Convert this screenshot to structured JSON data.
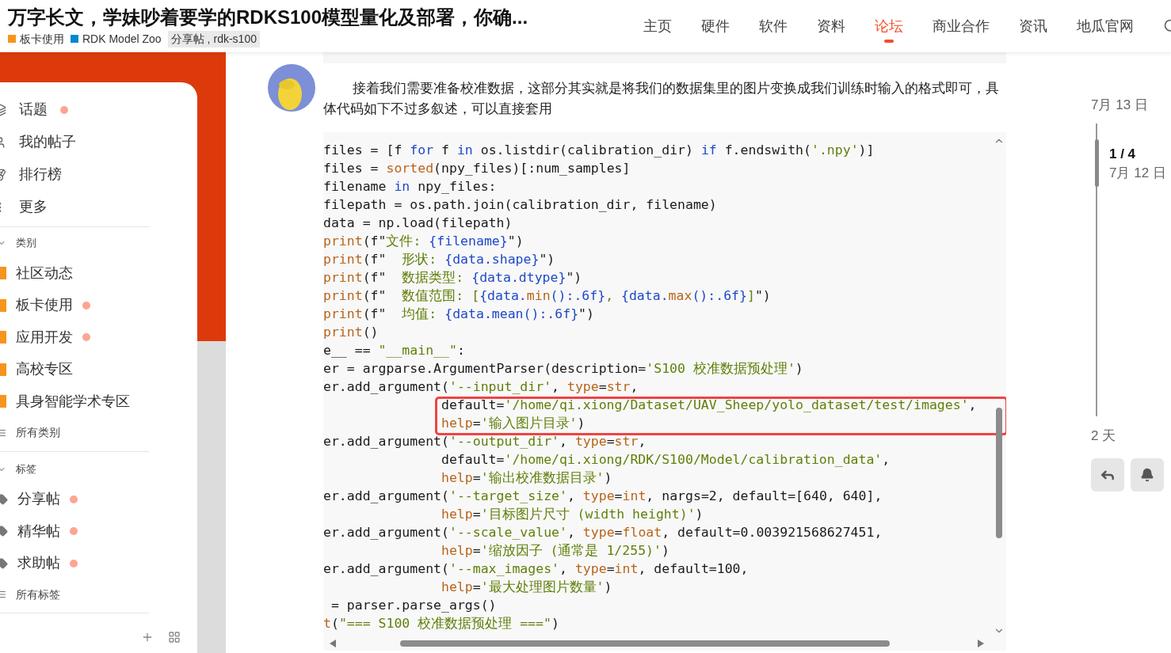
{
  "header": {
    "title": "万字长文，学妹吵着要学的RDKS100模型量化及部署，你确...",
    "categories": [
      {
        "name": "板卡使用",
        "color": "#f7941d"
      },
      {
        "name": "RDK Model Zoo",
        "color": "#0088cc"
      }
    ],
    "tags": [
      "分享帖",
      "rdk-s100"
    ],
    "tag_separator": ",",
    "nav": [
      {
        "label": "主页",
        "selected": false
      },
      {
        "label": "硬件",
        "selected": false
      },
      {
        "label": "软件",
        "selected": false
      },
      {
        "label": "资料",
        "selected": false
      },
      {
        "label": "论坛",
        "selected": true
      },
      {
        "label": "商业合作",
        "selected": false
      },
      {
        "label": "资讯",
        "selected": false
      },
      {
        "label": "地瓜官网",
        "selected": false
      }
    ]
  },
  "sidebar": {
    "items": [
      {
        "label": "话题",
        "kind": "topics",
        "unread": true
      },
      {
        "label": "我的帖子",
        "kind": "user",
        "unread": false
      },
      {
        "label": "排行榜",
        "kind": "ranking",
        "unread": false
      },
      {
        "label": "更多",
        "kind": "more",
        "unread": false
      }
    ],
    "categories": {
      "heading": "类别",
      "expanded": true,
      "items": [
        {
          "label": "社区动态",
          "color": "#f7941d",
          "unread": false
        },
        {
          "label": "板卡使用",
          "color": "#f7941d",
          "unread": true
        },
        {
          "label": "应用开发",
          "color": "#f7941d",
          "unread": true
        },
        {
          "label": "高校专区",
          "color": "#f7941d",
          "unread": false
        },
        {
          "label": "具身智能学术专区",
          "color": "#f7941d",
          "unread": false
        }
      ],
      "footer": "所有类别"
    },
    "tags": {
      "heading": "标签",
      "expanded": true,
      "items": [
        {
          "label": "分享帖",
          "unread": true
        },
        {
          "label": "精华帖",
          "unread": true
        },
        {
          "label": "求助帖",
          "unread": true
        }
      ],
      "footer": "所有标签"
    }
  },
  "post": {
    "paragraph": "接着我们需要准备校准数据，这部分其实就是将我们的数据集里的图片变换成我们训练时输入的格式即可，具体代码如下不过多叙述，可以直接套用",
    "code_blocks": [
      {
        "kind": "plain",
        "lines": [
          {
            "kind": "statement",
            "segments": [
              {
                "text": "files = [f ",
                "kind": "plain"
              },
              {
                "text": "for",
                "kind": "keyword"
              },
              {
                "text": " f ",
                "kind": "plain"
              },
              {
                "text": "in",
                "kind": "keyword"
              },
              {
                "text": " os.listdir(calibration_dir) ",
                "kind": "plain"
              },
              {
                "text": "if",
                "kind": "keyword"
              },
              {
                "text": " f.endswith(",
                "kind": "plain"
              },
              {
                "text": "'.npy'",
                "kind": "string"
              },
              {
                "text": ")]",
                "kind": "plain"
              }
            ]
          },
          {
            "kind": "statement",
            "segments": [
              {
                "text": "files = ",
                "kind": "plain"
              },
              {
                "text": "sorted",
                "kind": "builtin"
              },
              {
                "text": "(npy_files)[:num_samples]",
                "kind": "plain"
              }
            ]
          },
          {
            "kind": "statement",
            "segments": [
              {
                "text": "filename ",
                "kind": "plain"
              },
              {
                "text": "in",
                "kind": "keyword"
              },
              {
                "text": " npy_files:",
                "kind": "plain"
              }
            ]
          },
          {
            "kind": "statement",
            "segments": [
              {
                "text": "filepath = os.path.join(calibration_dir, filename)",
                "kind": "plain"
              }
            ]
          },
          {
            "kind": "statement",
            "segments": [
              {
                "text": "data = np.load(filepath)",
                "kind": "plain"
              }
            ]
          },
          {
            "kind": "statement",
            "segments": [
              {
                "text": "print",
                "kind": "builtin"
              },
              {
                "text": "(f\"",
                "kind": "plain"
              },
              {
                "text": "文件: ",
                "kind": "string"
              },
              {
                "text": "{filename}",
                "kind": "keyword"
              },
              {
                "text": "\")",
                "kind": "plain"
              }
            ]
          },
          {
            "kind": "statement",
            "segments": [
              {
                "text": "print",
                "kind": "builtin"
              },
              {
                "text": "(f\"  ",
                "kind": "plain"
              },
              {
                "text": "形状: ",
                "kind": "string"
              },
              {
                "text": "{data.shape}",
                "kind": "keyword"
              },
              {
                "text": "\")",
                "kind": "plain"
              }
            ]
          },
          {
            "kind": "statement",
            "segments": [
              {
                "text": "print",
                "kind": "builtin"
              },
              {
                "text": "(f\"  ",
                "kind": "plain"
              },
              {
                "text": "数据类型: ",
                "kind": "string"
              },
              {
                "text": "{data.dtype}",
                "kind": "keyword"
              },
              {
                "text": "\")",
                "kind": "plain"
              }
            ]
          },
          {
            "kind": "statement",
            "segments": [
              {
                "text": "print",
                "kind": "builtin"
              },
              {
                "text": "(f\"  ",
                "kind": "plain"
              },
              {
                "text": "数值范围: [",
                "kind": "string"
              },
              {
                "text": "{data.",
                "kind": "keyword"
              },
              {
                "text": "min",
                "kind": "builtin"
              },
              {
                "text": "():.6f}",
                "kind": "keyword"
              },
              {
                "text": ", ",
                "kind": "string"
              },
              {
                "text": "{data.",
                "kind": "keyword"
              },
              {
                "text": "max",
                "kind": "builtin"
              },
              {
                "text": "():.6f}",
                "kind": "keyword"
              },
              {
                "text": "]",
                "kind": "string"
              },
              {
                "text": "\")",
                "kind": "plain"
              }
            ]
          },
          {
            "kind": "statement",
            "segments": [
              {
                "text": "print",
                "kind": "builtin"
              },
              {
                "text": "(f\"  ",
                "kind": "plain"
              },
              {
                "text": "均值: ",
                "kind": "string"
              },
              {
                "text": "{data.mean():.6f}",
                "kind": "keyword"
              },
              {
                "text": "\")",
                "kind": "plain"
              }
            ]
          },
          {
            "kind": "statement",
            "segments": [
              {
                "text": "print",
                "kind": "builtin"
              },
              {
                "text": "()",
                "kind": "plain"
              }
            ]
          },
          {
            "kind": "statement",
            "segments": [
              {
                "text": "e__ == ",
                "kind": "plain"
              },
              {
                "text": "\"__main__\"",
                "kind": "string"
              },
              {
                "text": ":",
                "kind": "plain"
              }
            ]
          },
          {
            "kind": "statement",
            "segments": [
              {
                "text": "er = argparse.ArgumentParser(description=",
                "kind": "plain"
              },
              {
                "text": "'S100 校准数据预处理'",
                "kind": "string"
              },
              {
                "text": ")",
                "kind": "plain"
              }
            ]
          },
          {
            "kind": "statement",
            "segments": [
              {
                "text": "er.add_argument(",
                "kind": "plain"
              },
              {
                "text": "'--input_dir'",
                "kind": "string"
              },
              {
                "text": ", ",
                "kind": "plain"
              },
              {
                "text": "type",
                "kind": "builtin"
              },
              {
                "text": "=",
                "kind": "plain"
              },
              {
                "text": "str",
                "kind": "builtin"
              },
              {
                "text": ",",
                "kind": "plain"
              }
            ]
          }
        ]
      },
      {
        "kind": "highlight",
        "lines": [
          {
            "kind": "continuation",
            "segments": [
              {
                "text": "default=",
                "kind": "plain"
              },
              {
                "text": "'/home/qi.xiong/Dataset/UAV_Sheep/yolo_dataset/test/images'",
                "kind": "string"
              },
              {
                "text": ",",
                "kind": "plain"
              }
            ]
          },
          {
            "kind": "continuation",
            "segments": [
              {
                "text": "help",
                "kind": "builtin"
              },
              {
                "text": "=",
                "kind": "plain"
              },
              {
                "text": "'输入图片目录'",
                "kind": "string"
              },
              {
                "text": ")",
                "kind": "plain"
              }
            ]
          }
        ]
      },
      {
        "kind": "plain",
        "lines": [
          {
            "kind": "statement",
            "segments": [
              {
                "text": "er.add_argument(",
                "kind": "plain"
              },
              {
                "text": "'--output_dir'",
                "kind": "string"
              },
              {
                "text": ", ",
                "kind": "plain"
              },
              {
                "text": "type",
                "kind": "builtin"
              },
              {
                "text": "=",
                "kind": "plain"
              },
              {
                "text": "str",
                "kind": "builtin"
              },
              {
                "text": ",",
                "kind": "plain"
              }
            ]
          },
          {
            "kind": "continuation",
            "segments": [
              {
                "text": "default=",
                "kind": "plain"
              },
              {
                "text": "'/home/qi.xiong/RDK/S100/Model/calibration_data'",
                "kind": "string"
              },
              {
                "text": ",",
                "kind": "plain"
              }
            ]
          },
          {
            "kind": "continuation",
            "segments": [
              {
                "text": "help",
                "kind": "builtin"
              },
              {
                "text": "=",
                "kind": "plain"
              },
              {
                "text": "'输出校准数据目录'",
                "kind": "string"
              },
              {
                "text": ")",
                "kind": "plain"
              }
            ]
          },
          {
            "kind": "statement",
            "segments": [
              {
                "text": "er.add_argument(",
                "kind": "plain"
              },
              {
                "text": "'--target_size'",
                "kind": "string"
              },
              {
                "text": ", ",
                "kind": "plain"
              },
              {
                "text": "type",
                "kind": "builtin"
              },
              {
                "text": "=",
                "kind": "plain"
              },
              {
                "text": "int",
                "kind": "builtin"
              },
              {
                "text": ", nargs=2, default=[640, 640],",
                "kind": "plain"
              }
            ]
          },
          {
            "kind": "continuation",
            "segments": [
              {
                "text": "help",
                "kind": "builtin"
              },
              {
                "text": "=",
                "kind": "plain"
              },
              {
                "text": "'目标图片尺寸 (width height)'",
                "kind": "string"
              },
              {
                "text": ")",
                "kind": "plain"
              }
            ]
          },
          {
            "kind": "statement",
            "segments": [
              {
                "text": "er.add_argument(",
                "kind": "plain"
              },
              {
                "text": "'--scale_value'",
                "kind": "string"
              },
              {
                "text": ", ",
                "kind": "plain"
              },
              {
                "text": "type",
                "kind": "builtin"
              },
              {
                "text": "=",
                "kind": "plain"
              },
              {
                "text": "float",
                "kind": "builtin"
              },
              {
                "text": ", default=0.003921568627451,",
                "kind": "plain"
              }
            ]
          },
          {
            "kind": "continuation",
            "segments": [
              {
                "text": "help",
                "kind": "builtin"
              },
              {
                "text": "=",
                "kind": "plain"
              },
              {
                "text": "'缩放因子 (通常是 1/255)'",
                "kind": "string"
              },
              {
                "text": ")",
                "kind": "plain"
              }
            ]
          },
          {
            "kind": "statement",
            "segments": [
              {
                "text": "er.add_argument(",
                "kind": "plain"
              },
              {
                "text": "'--max_images'",
                "kind": "string"
              },
              {
                "text": ", ",
                "kind": "plain"
              },
              {
                "text": "type",
                "kind": "builtin"
              },
              {
                "text": "=",
                "kind": "plain"
              },
              {
                "text": "int",
                "kind": "builtin"
              },
              {
                "text": ", default=100,",
                "kind": "plain"
              }
            ]
          },
          {
            "kind": "continuation",
            "segments": [
              {
                "text": "help",
                "kind": "builtin"
              },
              {
                "text": "=",
                "kind": "plain"
              },
              {
                "text": "'最大处理图片数量'",
                "kind": "string"
              },
              {
                "text": ")",
                "kind": "plain"
              }
            ]
          },
          {
            "kind": "statement",
            "segments": [
              {
                "text": " = parser.parse_args()",
                "kind": "plain"
              }
            ]
          },
          {
            "kind": "statement",
            "segments": [
              {
                "text": "t",
                "kind": "builtin"
              },
              {
                "text": "(",
                "kind": "plain"
              },
              {
                "text": "\"=== S100 校准数据预处理 ===\"",
                "kind": "string"
              },
              {
                "text": ")",
                "kind": "plain"
              }
            ]
          }
        ]
      }
    ]
  },
  "timeline": {
    "top_date": "7月 13 日",
    "position": "1 / 4",
    "position_date": "7月 12 日",
    "bottom_label": "2 天"
  }
}
